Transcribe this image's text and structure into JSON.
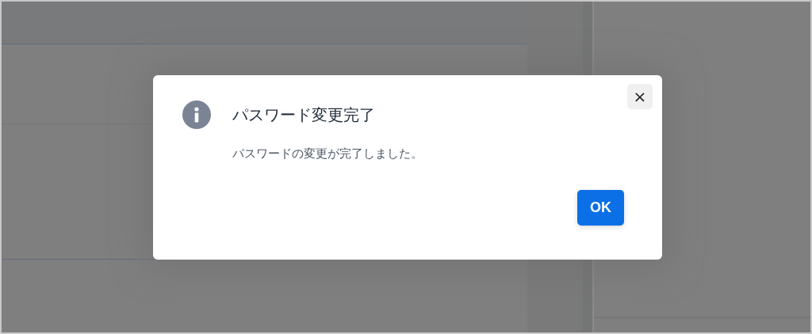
{
  "dialog": {
    "title": "パスワード変更完了",
    "message": "パスワードの変更が完了しました。",
    "close": "×",
    "buttons": [
      {
        "label": "OK",
        "kind": "primary"
      }
    ]
  }
}
